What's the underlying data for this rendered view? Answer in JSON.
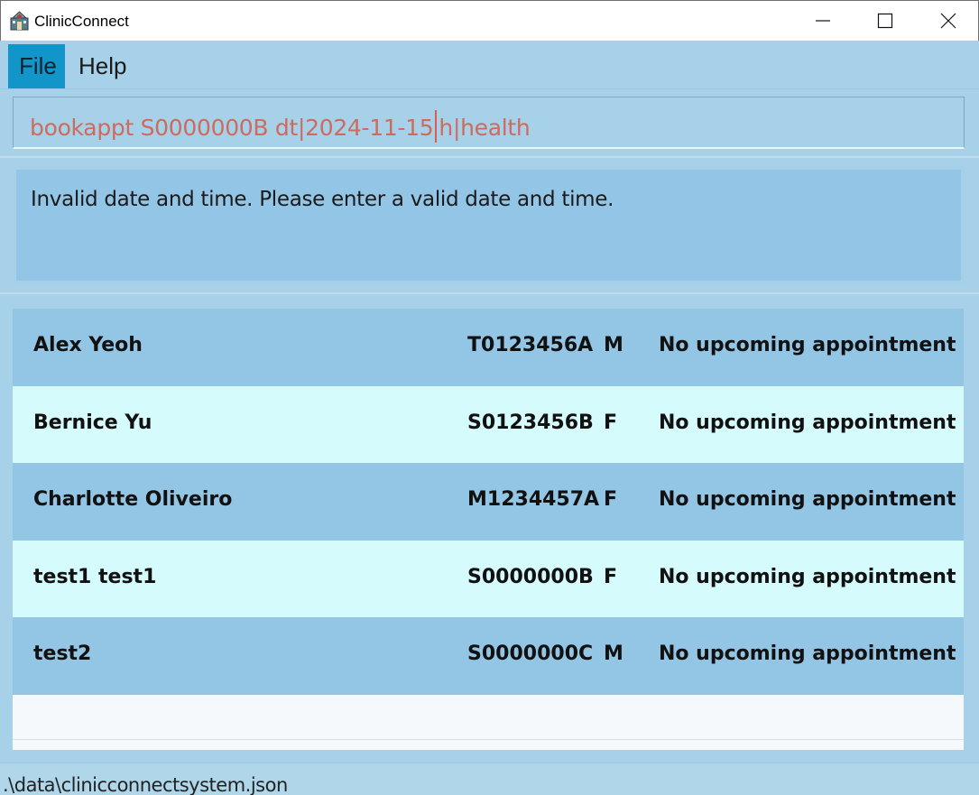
{
  "window": {
    "title": "ClinicConnect",
    "icon": "clinic-app-icon",
    "controls": [
      "minimize-icon",
      "maximize-icon",
      "close-icon"
    ]
  },
  "menu": {
    "file_label": "File",
    "help_label": "Help",
    "active": "File"
  },
  "command": {
    "text_before_caret": "bookappt S0000000B dt|2024-11-15",
    "text_after_caret": "h|health"
  },
  "result": {
    "message": "Invalid date and time. Please enter a valid date and time."
  },
  "patients": [
    {
      "name": "Alex Yeoh",
      "nric": "T0123456A",
      "sex": "M",
      "appointment": "No upcoming appointment"
    },
    {
      "name": "Bernice Yu",
      "nric": "S0123456B",
      "sex": "F",
      "appointment": "No upcoming appointment"
    },
    {
      "name": "Charlotte Oliveiro",
      "nric": "M1234457A",
      "sex": "F",
      "appointment": "No upcoming appointment"
    },
    {
      "name": "test1 test1",
      "nric": "S0000000B",
      "sex": "F",
      "appointment": "No upcoming appointment"
    },
    {
      "name": "test2",
      "nric": "S0000000C",
      "sex": "M",
      "appointment": "No upcoming appointment"
    }
  ],
  "status": {
    "file_path": ".\\data\\clinicconnectsystem.json"
  },
  "colors": {
    "background": "#a7d1e8",
    "menu_active": "#1296c9",
    "command_text": "#cd6b5e",
    "row_odd": "#93c5e5",
    "row_even": "#d5fbfd"
  }
}
